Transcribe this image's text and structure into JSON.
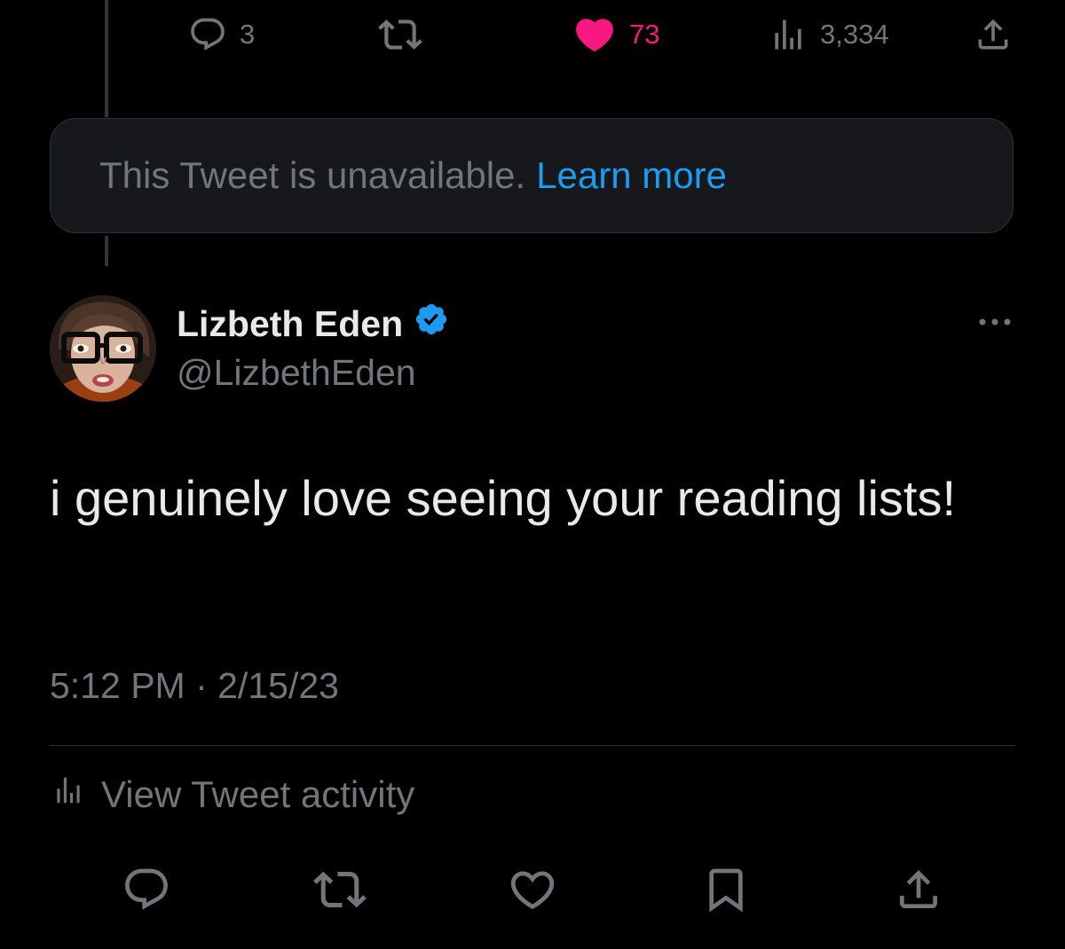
{
  "parent_actions": {
    "reply_count": "3",
    "like_count": "73",
    "view_count": "3,334"
  },
  "unavailable": {
    "message": "This Tweet is unavailable.",
    "link": "Learn more"
  },
  "tweet": {
    "author_name": "Lizbeth Eden",
    "author_handle": "@LizbethEden",
    "text": "i genuinely love seeing your reading lists!",
    "timestamp": "5:12 PM · 2/15/23"
  },
  "activity": {
    "label": "View Tweet activity"
  },
  "colors": {
    "background": "#000000",
    "text_primary": "#e7e9ea",
    "text_secondary": "#71767b",
    "accent_blue": "#1d9bf0",
    "like_pink": "#f91880",
    "card_background": "#16181c",
    "border": "#2f3336"
  },
  "icons": {
    "reply": "reply-icon",
    "retweet": "retweet-icon",
    "like": "heart-icon",
    "views": "views-chart-icon",
    "share": "share-icon",
    "bookmark": "bookmark-icon",
    "verified": "verified-badge-icon",
    "more": "more-dots-icon"
  }
}
